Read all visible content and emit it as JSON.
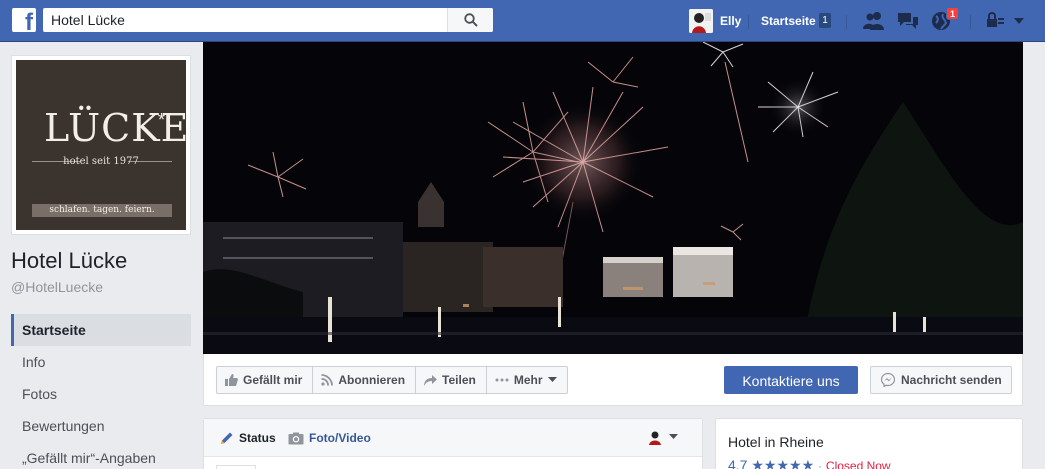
{
  "topbar": {
    "logo_letter": "f",
    "search_value": "Hotel Lücke",
    "user_name": "Elly",
    "home_label": "Startseite",
    "home_count": "1",
    "notification_count": "1",
    "brand_color": "#4267b2"
  },
  "profile": {
    "logo": {
      "wordmark": "LÜCKE",
      "star": "*",
      "tagline": "hotel seit 1977",
      "bar_text": "schlafen. tagen. feiern."
    },
    "page_name": "Hotel Lücke",
    "handle": "@HotelLuecke"
  },
  "nav": {
    "items": [
      {
        "label": "Startseite",
        "active": true
      },
      {
        "label": "Info",
        "active": false
      },
      {
        "label": "Fotos",
        "active": false
      },
      {
        "label": "Bewertungen",
        "active": false
      },
      {
        "label": "„Gefällt mir“-Angaben",
        "active": false
      }
    ]
  },
  "actions": {
    "like": "Gefällt mir",
    "follow": "Abonnieren",
    "share": "Teilen",
    "more": "Mehr",
    "cta": "Kontaktiere uns",
    "message": "Nachricht senden"
  },
  "composer": {
    "status_tab": "Status",
    "photo_tab": "Foto/Video"
  },
  "info_card": {
    "category": "Hotel in Rheine",
    "rating": "4,7",
    "stars": "★★★★★",
    "separator": "·",
    "status": "Closed Now"
  }
}
